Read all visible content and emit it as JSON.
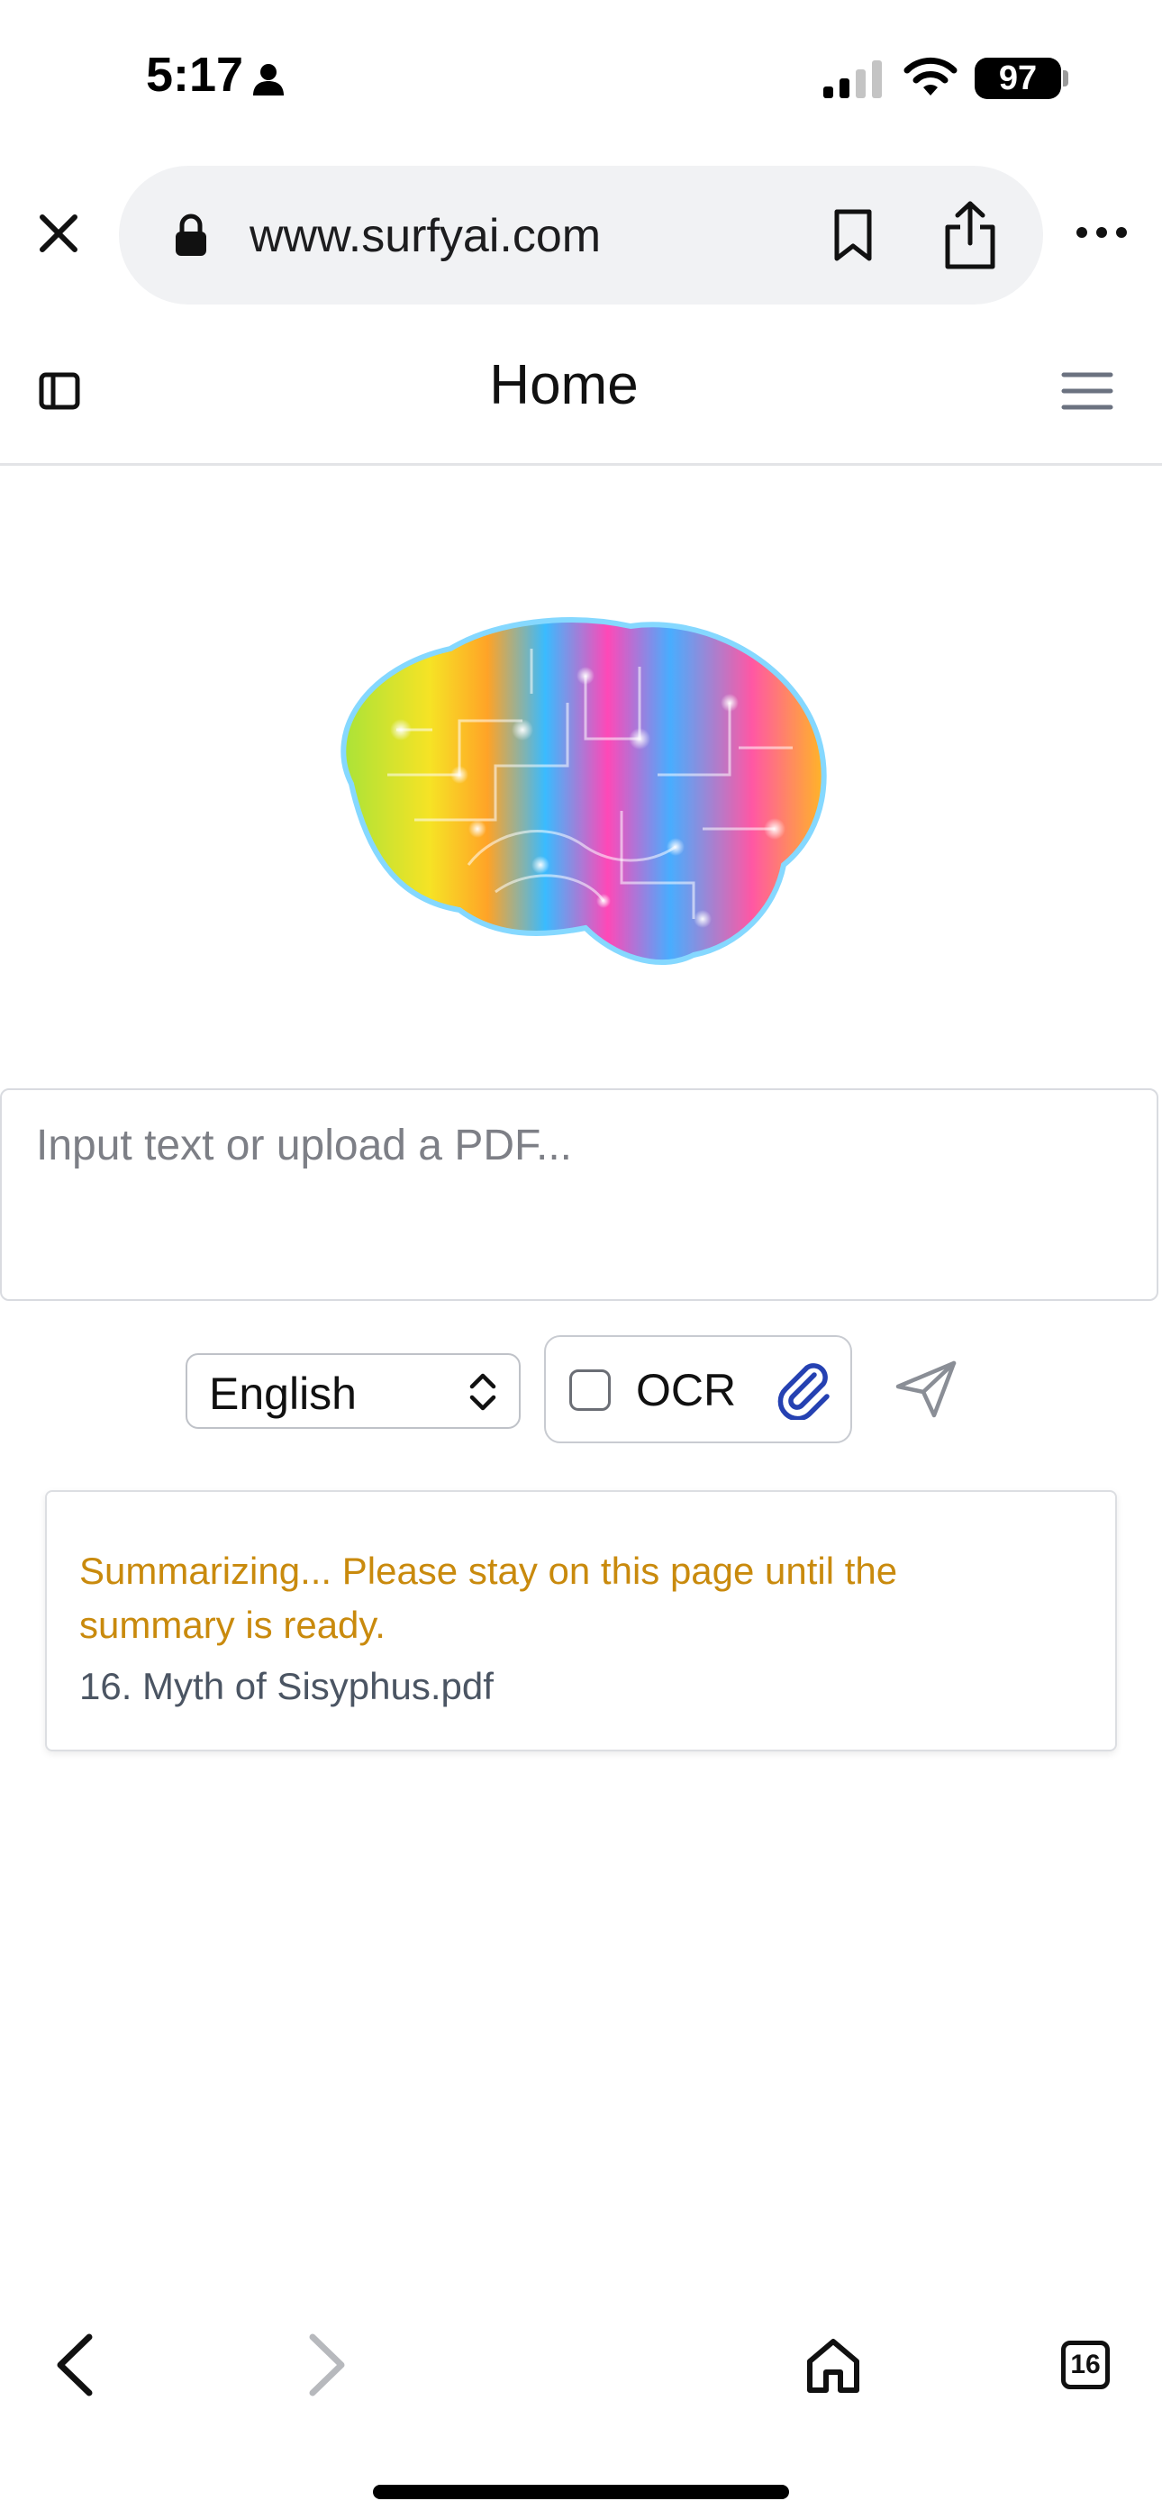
{
  "status_bar": {
    "time": "5:17",
    "battery": "97",
    "icons": [
      "person-icon",
      "signal-icon",
      "wifi-icon",
      "battery-icon"
    ]
  },
  "browser": {
    "url": "www.surfyai.com",
    "icons": [
      "close-icon",
      "lock-icon",
      "bookmark-icon",
      "share-icon",
      "more-icon"
    ]
  },
  "header": {
    "title": "Home",
    "icons": [
      "sidebar-toggle-icon",
      "hamburger-menu-icon"
    ]
  },
  "input": {
    "placeholder": "Input text or upload a PDF...",
    "value": ""
  },
  "controls": {
    "language_options": [
      "English"
    ],
    "language_selected": "English",
    "ocr_label": "OCR",
    "ocr_checked": false,
    "icons": [
      "paperclip-icon",
      "send-icon"
    ]
  },
  "status_card": {
    "message": "Summarizing... Please stay on this page until the summary is ready.",
    "file_name": "16. Myth of Sisyphus.pdf"
  },
  "toolbar": {
    "tabs_count": "16",
    "icons": [
      "back-arrow-icon",
      "forward-arrow-icon",
      "home-icon",
      "tabs-icon"
    ]
  },
  "colors": {
    "accent_attach": "#2541b2",
    "status_text": "#c98a0d",
    "file_text": "#4b5563",
    "url_bar_bg": "#f1f2f4"
  }
}
